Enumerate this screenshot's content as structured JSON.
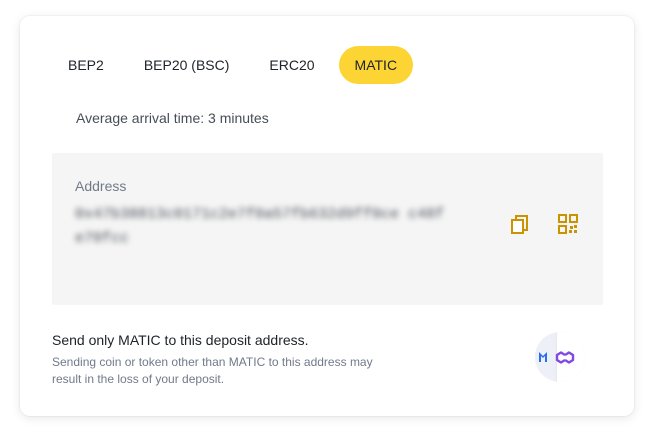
{
  "network_tabs": [
    {
      "label": "BEP2"
    },
    {
      "label": "BEP20 (BSC)"
    },
    {
      "label": "ERC20"
    },
    {
      "label": "MATIC",
      "active": true
    }
  ],
  "arrival_time": "Average arrival time: 3 minutes",
  "address": {
    "label": "Address",
    "value": "0x47b38813c0171c2e7f0a57fb632d9ff0ce c48fe70fcc"
  },
  "icons": {
    "copy": "copy-icon",
    "qr": "qr-code-icon",
    "coin": "matic-polygon-logo"
  },
  "warning": {
    "title": "Send only MATIC to this deposit address.",
    "text": "Sending coin or token other than MATIC to this address may result in the loss of your deposit."
  },
  "colors": {
    "accent": "#fcd535",
    "icon_gold": "#c99400",
    "polygon_purple": "#8247e5",
    "matic_blue": "#2b6def"
  }
}
